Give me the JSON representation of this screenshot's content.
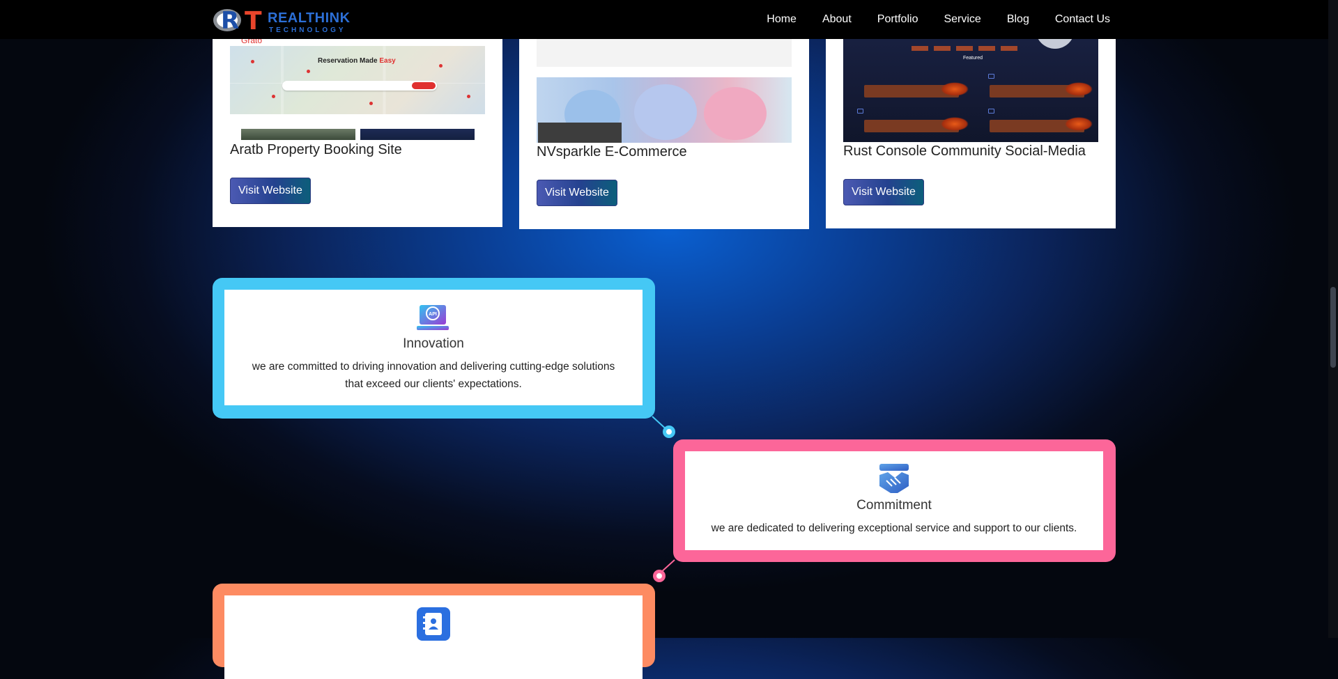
{
  "header": {
    "logo_letter_r": "R",
    "logo_letter_t": "T",
    "logo_name": "REALTHINK",
    "logo_sub": "TECHNOLOGY",
    "nav": [
      "Home",
      "About",
      "Portfolio",
      "Service",
      "Blog",
      "Contact Us"
    ]
  },
  "portfolio": [
    {
      "title": "Aratb Property Booking Site",
      "button": "Visit Website",
      "shot_heading": "Reservation Made ",
      "shot_heading_accent": "Easy",
      "shot_top": "Grato"
    },
    {
      "title": "NVsparkle E-Commerce",
      "button": "Visit Website"
    },
    {
      "title": "Rust Console Community Social-Media",
      "button": "Visit Website",
      "shot_feature": "Featured"
    }
  ],
  "values": [
    {
      "name": "Innovation",
      "icon": "api-laptop-icon",
      "text": "we are committed to driving innovation and delivering cutting-edge solutions that exceed our clients' expectations.",
      "color": "#45c8f5"
    },
    {
      "name": "Commitment",
      "icon": "handshake-icon",
      "text": "we are dedicated to delivering exceptional service and support to our clients.",
      "color": "#fc6699"
    },
    {
      "name": "",
      "icon": "contact-book-icon",
      "text": "",
      "color": "#fd8b62"
    }
  ],
  "colors": {
    "topbar": "#000000",
    "button_start": "#4c5ab3",
    "button_end": "#0c5f7a"
  }
}
